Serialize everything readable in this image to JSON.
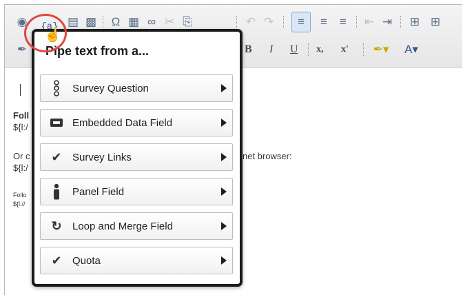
{
  "toolbar": {
    "bold_label": "B",
    "italic_label": "I",
    "underline_label": "U",
    "subscript_label": "x,",
    "superscript_label": "x'",
    "omega_label": "Ω",
    "pipe_text_icon_label": "{a}"
  },
  "editor_body": {
    "line1": "Foll",
    "line2": "${l:/",
    "line3": "Or c",
    "line4": "${l:/",
    "line3_suffix": "net browser:",
    "line5": "Follo",
    "line6": "${l://"
  },
  "popup": {
    "title": "Pipe text from a...",
    "items": [
      {
        "label": "Survey Question",
        "icon": "survey-question-icon"
      },
      {
        "label": "Embedded Data Field",
        "icon": "embedded-data-icon"
      },
      {
        "label": "Survey Links",
        "icon": "checkmark-icon"
      },
      {
        "label": "Panel Field",
        "icon": "person-icon"
      },
      {
        "label": "Loop and Merge Field",
        "icon": "loop-icon"
      },
      {
        "label": "Quota",
        "icon": "checkmark-icon"
      }
    ]
  },
  "colors": {
    "highlight_circle": "#e2463f",
    "popup_border": "#1b1b1b",
    "toolbar_icon": "#5b6f8c"
  }
}
